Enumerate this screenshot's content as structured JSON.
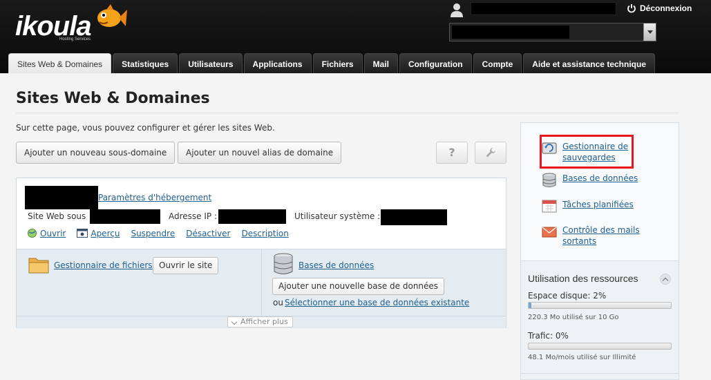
{
  "header": {
    "logo_text": "ikoula",
    "logo_sub": "Hosting Services",
    "logout_label": "Déconnexion"
  },
  "tabs": [
    {
      "label": "Sites Web & Domaines",
      "active": true
    },
    {
      "label": "Statistiques"
    },
    {
      "label": "Utilisateurs"
    },
    {
      "label": "Applications"
    },
    {
      "label": "Fichiers"
    },
    {
      "label": "Mail"
    },
    {
      "label": "Configuration"
    },
    {
      "label": "Compte"
    },
    {
      "label": "Aide et assistance technique"
    }
  ],
  "main": {
    "title": "Sites Web & Domaines",
    "intro": "Sur cette page, vous pouvez configurer et gérer les sites Web.",
    "add_subdomain": "Ajouter un nouveau sous-domaine",
    "add_alias": "Ajouter un nouvel alias de domaine",
    "help_icon": "?",
    "site": {
      "hosting_link": "Paramètres d'hébergement",
      "website_label": "Site Web sous",
      "ip_label": "Adresse IP :",
      "sysuser_label": "Utilisateur système :",
      "actions": {
        "open": "Ouvrir",
        "preview": "Aperçu",
        "suspend": "Suspendre",
        "disable": "Désactiver",
        "description": "Description"
      },
      "file_manager": "Gestionnaire de fichiers",
      "open_site": "Ouvrir le site",
      "databases": "Bases de données",
      "add_db": "Ajouter une nouvelle base de données",
      "or": "ou",
      "select_db": "Sélectionner une base de données existante",
      "show_more": "Afficher plus"
    }
  },
  "sidebar": {
    "backup_line1": "Gestionnaire de",
    "backup_line2": "sauvegardes",
    "databases": "Bases de données",
    "scheduled": "Tâches planifiées",
    "mail_line1": "Contrôle des mails",
    "mail_line2": "sortants",
    "resources_title": "Utilisation des ressources",
    "disk_label": "Espace disque: 2%",
    "disk_percent": 2,
    "disk_sub": "220.3 Mo utilisé sur 10 Go",
    "traffic_label": "Trafic: 0%",
    "traffic_percent": 0,
    "traffic_sub": "48.1 Mo/mois utilisé sur Illimité"
  },
  "colors": {
    "highlight": "#e8161e",
    "link": "#1f5f8e"
  }
}
